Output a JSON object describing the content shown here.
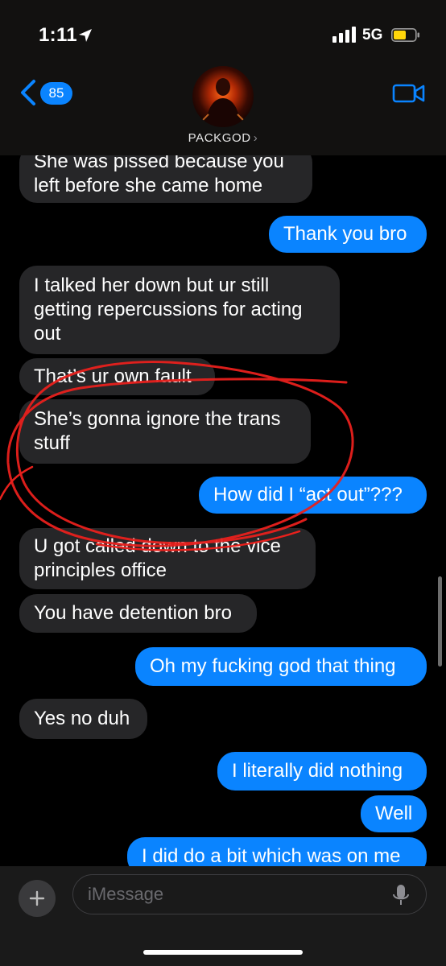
{
  "status_bar": {
    "time": "1:11",
    "network": "5G"
  },
  "header": {
    "back_count": "85",
    "contact_name": "PACKGOD",
    "contact_chevron": "›"
  },
  "messages": [
    {
      "dir": "in",
      "lines": [
        "She was pissed because you",
        "left before she came home"
      ]
    },
    {
      "dir": "out",
      "lines": [
        "Thank you bro"
      ]
    },
    {
      "dir": "in",
      "lines": [
        "I talked her down but ur still",
        "getting repercussions for acting",
        "out"
      ]
    },
    {
      "dir": "in",
      "lines": [
        "That’s ur own fault"
      ]
    },
    {
      "dir": "in",
      "lines": [
        "She’s gonna ignore the trans",
        "stuff"
      ]
    },
    {
      "dir": "out",
      "lines": [
        "How did I “act out”???"
      ]
    },
    {
      "dir": "in",
      "lines": [
        "U got called down to the vice",
        "principles office"
      ]
    },
    {
      "dir": "in",
      "lines": [
        "You have detention bro"
      ]
    },
    {
      "dir": "out",
      "lines": [
        "Oh my fucking god that thing"
      ]
    },
    {
      "dir": "in",
      "lines": [
        "Yes no duh"
      ]
    },
    {
      "dir": "out",
      "lines": [
        "I literally did nothing"
      ]
    },
    {
      "dir": "out",
      "lines": [
        "Well"
      ]
    },
    {
      "dir": "out",
      "lines": [
        "I did do a bit which was on me"
      ]
    }
  ],
  "input": {
    "placeholder": "iMessage"
  },
  "icons": {
    "back": "chevron-left-icon",
    "video": "video-camera-icon",
    "plus": "plus-icon",
    "mic": "microphone-icon",
    "location": "location-arrow-icon",
    "signal": "signal-bars-icon",
    "battery": "battery-icon"
  },
  "colors": {
    "accent": "#0a84ff",
    "incoming_bubble": "#262628",
    "annotation": "#e8201c",
    "battery_fill": "#ffd60a"
  }
}
